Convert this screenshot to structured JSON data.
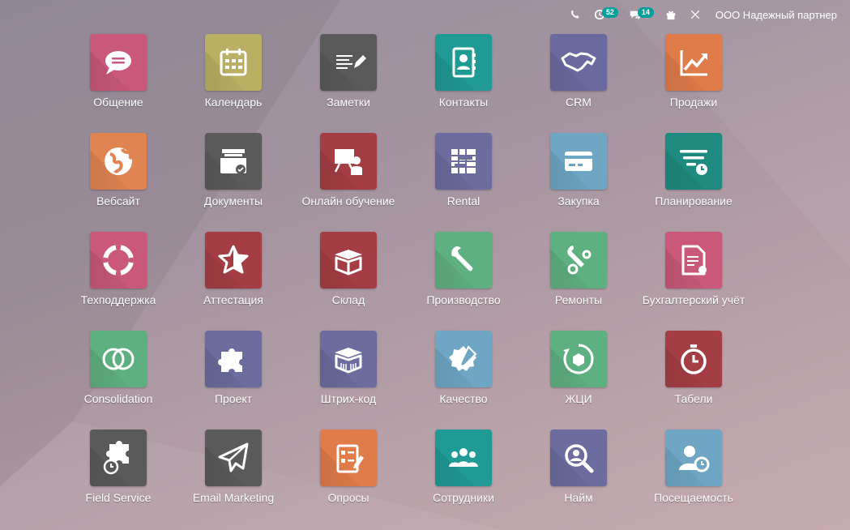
{
  "topbar": {
    "activity_badge": "52",
    "messages_badge": "14",
    "company": "ООО Надежный партнер"
  },
  "apps": [
    {
      "label": "Общение",
      "color": "#c9587a",
      "icon": "chat-icon"
    },
    {
      "label": "Календарь",
      "color": "#b9b064",
      "icon": "calendar-icon"
    },
    {
      "label": "Заметки",
      "color": "#5a5a5a",
      "icon": "notes-icon"
    },
    {
      "label": "Контакты",
      "color": "#1f9a95",
      "icon": "contacts-icon"
    },
    {
      "label": "CRM",
      "color": "#6b6aa0",
      "icon": "handshake-icon"
    },
    {
      "label": "Продажи",
      "color": "#e07b4a",
      "icon": "chart-up-icon"
    },
    {
      "label": "Вебсайт",
      "color": "#e08451",
      "icon": "globe-icon"
    },
    {
      "label": "Документы",
      "color": "#5a5a5a",
      "icon": "inbox-icon"
    },
    {
      "label": "Онлайн обучение",
      "color": "#a43e44",
      "icon": "teacher-icon"
    },
    {
      "label": "Rental",
      "color": "#6c6c9e",
      "icon": "table-icon"
    },
    {
      "label": "Закупка",
      "color": "#6ea6c4",
      "icon": "card-icon"
    },
    {
      "label": "Планирование",
      "color": "#1e8a80",
      "icon": "planning-icon"
    },
    {
      "label": "Техподдержка",
      "color": "#c9587a",
      "icon": "lifebuoy-icon"
    },
    {
      "label": "Аттестация",
      "color": "#a43e44",
      "icon": "star-icon"
    },
    {
      "label": "Склад",
      "color": "#a43e44",
      "icon": "box-icon"
    },
    {
      "label": "Производство",
      "color": "#5fb081",
      "icon": "wrench-icon"
    },
    {
      "label": "Ремонты",
      "color": "#5fb081",
      "icon": "repair-icon"
    },
    {
      "label": "Бухгалтерский учёт",
      "color": "#c9587a",
      "icon": "invoice-icon"
    },
    {
      "label": "Consolidation",
      "color": "#5fb081",
      "icon": "circles-icon"
    },
    {
      "label": "Проект",
      "color": "#6c6c9e",
      "icon": "puzzle-icon"
    },
    {
      "label": "Штрих-код",
      "color": "#6c6c9e",
      "icon": "barcode-box-icon"
    },
    {
      "label": "Качество",
      "color": "#6ea6c4",
      "icon": "quality-icon"
    },
    {
      "label": "ЖЦИ",
      "color": "#5fb081",
      "icon": "cycle-icon"
    },
    {
      "label": "Табели",
      "color": "#a43e44",
      "icon": "stopwatch-icon"
    },
    {
      "label": "Field Service",
      "color": "#5a5a5a",
      "icon": "puzzle-clock-icon"
    },
    {
      "label": "Email Marketing",
      "color": "#5a5a5a",
      "icon": "paper-plane-icon"
    },
    {
      "label": "Опросы",
      "color": "#e07b4a",
      "icon": "survey-icon"
    },
    {
      "label": "Сотрудники",
      "color": "#1f9a95",
      "icon": "users-icon"
    },
    {
      "label": "Найм",
      "color": "#6c6c9e",
      "icon": "search-person-icon"
    },
    {
      "label": "Посещаемость",
      "color": "#6ea6c4",
      "icon": "user-clock-icon"
    }
  ]
}
